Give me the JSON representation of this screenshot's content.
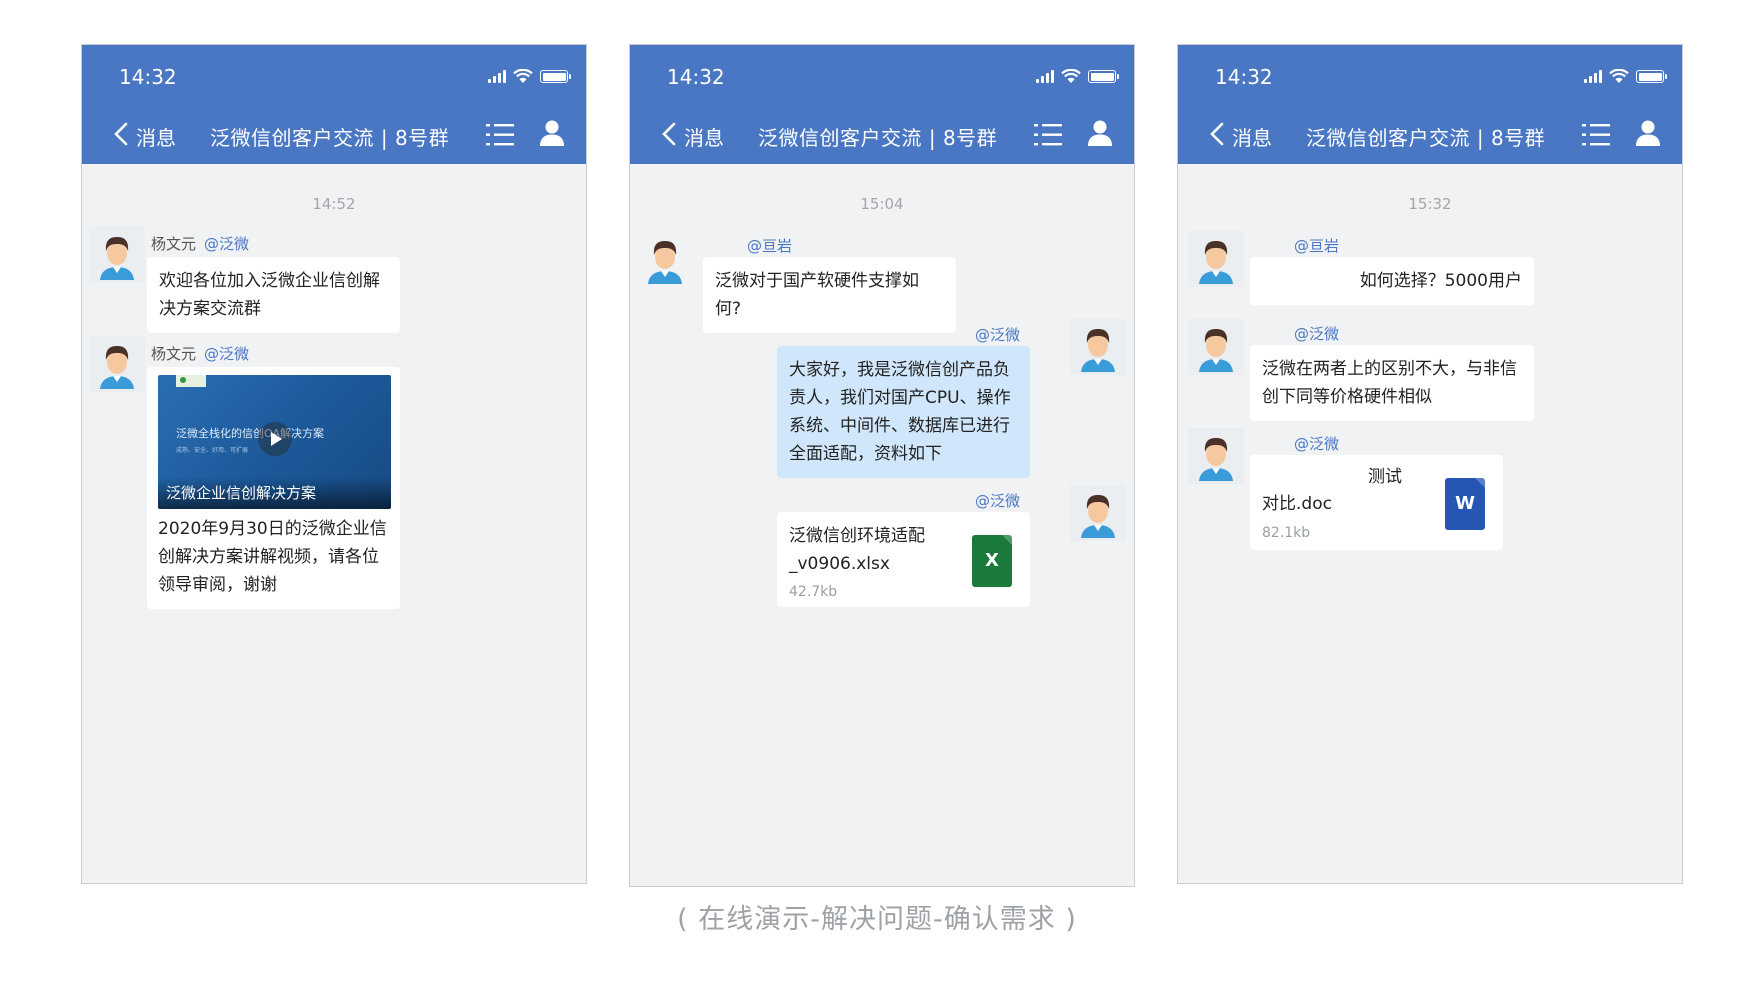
{
  "screens": [
    {
      "status_time": "14:32",
      "nav": {
        "back_label": "消息",
        "title": "泛微信创客户交流 | 8号群"
      },
      "time_separator": "14:52",
      "messages": [
        {
          "sender": "杨文元",
          "mention": "@泛微",
          "text": "欢迎各位加入泛微企业信创解决方案交流群"
        },
        {
          "sender": "杨文元",
          "mention": "@泛微",
          "video": {
            "title": "泛微全栈化的信创OA解决方案",
            "subtitle": "成熟、安全、好用、可扩展",
            "caption": "泛微企业信创解决方案"
          },
          "text": "2020年9月30日的泛微企业信创解决方案讲解视频，请各位领导审阅，谢谢"
        }
      ]
    },
    {
      "status_time": "14:32",
      "nav": {
        "back_label": "消息",
        "title": "泛微信创客户交流 | 8号群"
      },
      "time_separator": "15:04",
      "messages": [
        {
          "mention": "@亘岩",
          "text": "泛微对于国产软硬件支撑如何?"
        },
        {
          "mention": "@泛微",
          "text": "大家好，我是泛微信创产品负责人，我们对国产CPU、操作系统、中间件、数据库已进行全面适配，资料如下"
        },
        {
          "mention": "@泛微",
          "file": {
            "name": "泛微信创环境适配_v0906.xlsx",
            "size": "42.7kb",
            "icon_letter": "X"
          }
        }
      ]
    },
    {
      "status_time": "14:32",
      "nav": {
        "back_label": "消息",
        "title": "泛微信创客户交流 | 8号群"
      },
      "time_separator": "15:32",
      "messages": [
        {
          "mention": "@亘岩",
          "text": "如何选择？5000用户"
        },
        {
          "mention": "@泛微",
          "text": "泛微在两者上的区别不大，与非信创下同等价格硬件相似"
        },
        {
          "mention": "@泛微",
          "file": {
            "title": "测试",
            "name": "对比.doc",
            "size": "82.1kb",
            "icon_letter": "W"
          }
        }
      ]
    }
  ],
  "footer_caption": "( 在线演示-解决问题-确认需求 )",
  "colors": {
    "header": "#4a77c4",
    "chat_bg": "#f0f2f4",
    "own_bubble": "#cfe6fb",
    "excel": "#1a7a3c",
    "word": "#2556b4"
  },
  "icons": [
    "back-chevron-icon",
    "signal-icon",
    "wifi-icon",
    "battery-icon",
    "list-menu-icon",
    "user-icon",
    "avatar-icon",
    "play-icon",
    "excel-file-icon",
    "word-file-icon"
  ]
}
